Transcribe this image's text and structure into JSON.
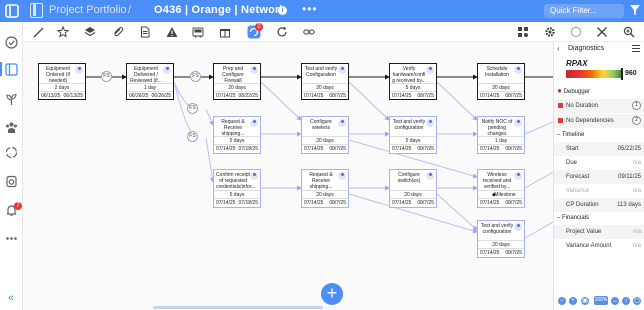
{
  "header": {
    "portfolio": "Project Portfolio",
    "separator": "/",
    "project_title": "O436 | Orange | Network",
    "more": "•••",
    "quick_filter": "Quick Filter..."
  },
  "sidebar": {
    "notification_count": "7",
    "expand": "«"
  },
  "toolbar": {
    "badge_count": "2"
  },
  "nodes": [
    {
      "id": "n1",
      "title": "Equipment Ordered (if needed)",
      "duration": "2 days",
      "start": "06/13/25",
      "end": "06/13/25",
      "critical": true
    },
    {
      "id": "n2",
      "title": "Equipment Delivered / Reviewed (if...",
      "duration": "1 day",
      "start": "06/26/25",
      "end": "06/26/25",
      "critical": true
    },
    {
      "id": "n3",
      "title": "Prep and Configure Firewall",
      "duration": "20 days",
      "start": "07/14/25",
      "end": "08/22/25",
      "critical": true
    },
    {
      "id": "n4",
      "title": "Test and verify Configuration",
      "duration": "20 days",
      "start": "07/14/25",
      "end": "08/7/25",
      "critical": true
    },
    {
      "id": "n5",
      "title": "Verify hardware/confi g received by...",
      "duration": "5 days",
      "start": "07/14/25",
      "end": "08/7/25",
      "critical": true
    },
    {
      "id": "n6",
      "title": "Schedule Installation",
      "duration": "20 days",
      "start": "07/14/25",
      "end": "08/7/25",
      "critical": true
    },
    {
      "id": "n7",
      "title": "Request & Receive shipping...",
      "duration": "5 days",
      "start": "07/14/25",
      "end": "07/18/25",
      "critical": false
    },
    {
      "id": "n8",
      "title": "Configure wireless",
      "duration": "20 days",
      "start": "07/14/25",
      "end": "08/7/25",
      "critical": false
    },
    {
      "id": "n9",
      "title": "Test and verify configuration",
      "duration": "5 days",
      "start": "07/14/25",
      "end": "08/7/25",
      "critical": false
    },
    {
      "id": "n10",
      "title": "Notify NOC of pending changes",
      "duration": "1 day",
      "start": "07/14/25",
      "end": "08/7/25",
      "critical": false
    },
    {
      "id": "n11",
      "title": "Confirm receipt of requested credentials/infor...",
      "duration": "5 days",
      "start": "07/14/25",
      "end": "07/18/25",
      "critical": false
    },
    {
      "id": "n12",
      "title": "Request & Receive shipping...",
      "duration": "20 days",
      "start": "07/14/25",
      "end": "08/7/25",
      "critical": false
    },
    {
      "id": "n13",
      "title": "Configure switch(es)",
      "duration": "20 days",
      "start": "07/14/25",
      "end": "08/7/25",
      "critical": false
    },
    {
      "id": "n14",
      "title": "Wireless received and verified by...",
      "milestone": "Milestone",
      "start": "07/14/25",
      "end": "08/7/25",
      "critical": false
    },
    {
      "id": "n15",
      "title": "Test and verify configuration",
      "duration": "20 days",
      "start": "07/14/25",
      "end": "08/7/25",
      "critical": false
    }
  ],
  "connectors": [
    "FS",
    "FS",
    "FS",
    "FS"
  ],
  "add_button": "+",
  "diagnostics": {
    "title": "Diagnostics",
    "score_label": "RPAX",
    "score": "960",
    "debugger": {
      "title": "Debugger",
      "no_duration_label": "No Duration",
      "no_duration_count": "1",
      "no_dependencies_label": "No Dependencies",
      "no_dependencies_count": "2"
    },
    "timeline": {
      "title": "Timeline",
      "start_label": "Start",
      "start_value": "05/22/25",
      "due_label": "Due",
      "due_value": "n/a",
      "forecast_label": "Forecast",
      "forecast_value": "09/11/25",
      "variance_label": "Variance",
      "variance_value": "n/a",
      "cp_label": "CP Duration",
      "cp_value": "113 days"
    },
    "financials": {
      "title": "Financials",
      "project_value_label": "Project Value",
      "project_value": "n/a",
      "variance_amount_label": "Variance Amount",
      "variance_amount": "n/a"
    },
    "zoom": "100%"
  },
  "colors": {
    "brand": "#4c8ef7",
    "critical_border": "#1a1a1a",
    "normal_border": "#a7b1f0",
    "link": "#b7c0f3"
  }
}
